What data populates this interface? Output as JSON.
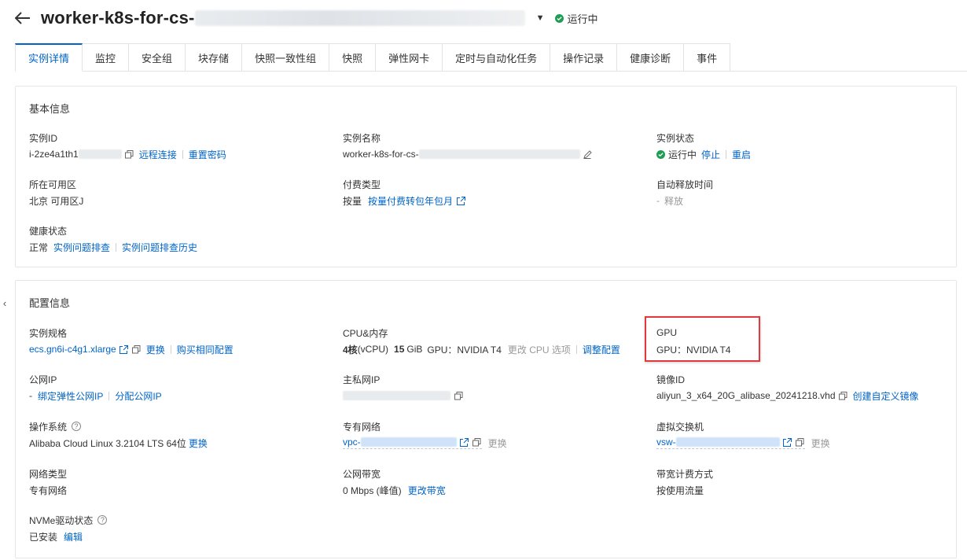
{
  "header": {
    "title": "worker-k8s-for-cs-",
    "status": "运行中"
  },
  "tabs": [
    "实例详情",
    "监控",
    "安全组",
    "块存储",
    "快照一致性组",
    "快照",
    "弹性网卡",
    "定时与自动化任务",
    "操作记录",
    "健康诊断",
    "事件"
  ],
  "basic": {
    "title": "基本信息",
    "instance_id": {
      "label": "实例ID",
      "value": "i-2ze4a1th1",
      "remote": "远程连接",
      "reset": "重置密码"
    },
    "instance_name": {
      "label": "实例名称",
      "value": "worker-k8s-for-cs-"
    },
    "instance_status": {
      "label": "实例状态",
      "value": "运行中",
      "stop": "停止",
      "restart": "重启"
    },
    "zone": {
      "label": "所在可用区",
      "value": "北京 可用区J"
    },
    "billing": {
      "label": "付费类型",
      "value": "按量",
      "convert": "按量付费转包年包月"
    },
    "auto_release": {
      "label": "自动释放时间",
      "dash": "-",
      "value": "释放"
    },
    "health": {
      "label": "健康状态",
      "value": "正常",
      "diagnose": "实例问题排查",
      "history": "实例问题排查历史"
    }
  },
  "config": {
    "title": "配置信息",
    "spec": {
      "label": "实例规格",
      "value": "ecs.gn6i-c4g1.xlarge",
      "change": "更换",
      "buy_same": "购买相同配置"
    },
    "cpu_mem": {
      "label": "CPU&内存",
      "cpu_num": "4核",
      "cpu_unit": "(vCPU)",
      "mem_num": "15",
      "mem_unit": "GiB",
      "gpu_text": "GPU：NVIDIA T4",
      "change_cpu": "更改 CPU 选项",
      "adjust": "调整配置"
    },
    "gpu": {
      "label": "GPU",
      "value": "GPU：NVIDIA T4"
    },
    "public_ip": {
      "label": "公网IP",
      "dash": "-",
      "bind_eip": "绑定弹性公网IP",
      "assign": "分配公网IP"
    },
    "private_ip": {
      "label": "主私网IP"
    },
    "image_id": {
      "label": "镜像ID",
      "value": "aliyun_3_x64_20G_alibase_20241218.vhd",
      "create": "创建自定义镜像"
    },
    "os": {
      "label": "操作系统",
      "value": "Alibaba Cloud Linux 3.2104 LTS 64位",
      "change": "更换"
    },
    "vpc": {
      "label": "专有网络",
      "value": "vpc-",
      "change": "更换"
    },
    "vswitch": {
      "label": "虚拟交换机",
      "value": "vsw-",
      "change": "更换"
    },
    "network_type": {
      "label": "网络类型",
      "value": "专有网络"
    },
    "bandwidth": {
      "label": "公网带宽",
      "value": "0 Mbps (峰值)",
      "change": "更改带宽"
    },
    "bandwidth_billing": {
      "label": "带宽计费方式",
      "value": "按使用流量"
    },
    "nvme": {
      "label": "NVMe驱动状态",
      "value": "已安装",
      "edit": "编辑"
    }
  },
  "icons": {
    "back": "back-arrow-icon",
    "copy": "copy-icon",
    "external": "external-link-icon",
    "edit": "pencil-icon",
    "status": "check-circle-icon",
    "help": "question-circle-icon"
  },
  "colors": {
    "link": "#0064c8",
    "status_ok": "#1f9d55",
    "highlight": "#e0393e"
  }
}
